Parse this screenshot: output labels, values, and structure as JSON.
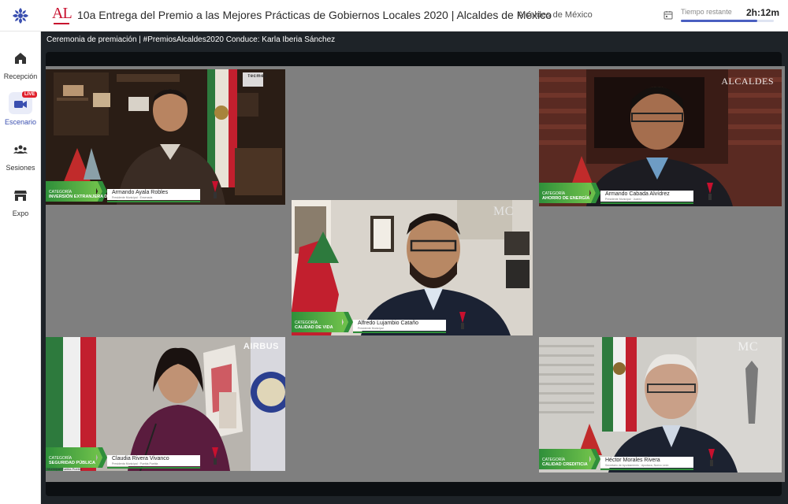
{
  "header": {
    "event_title": "10a Entrega del Premio a las Mejores Prácticas de Gobiernos Locales 2020 | Alcaldes de México",
    "org_name": "Alcaldes de México",
    "time_label": "Tiempo restante",
    "time_value": "2h:12m",
    "time_progress_fraction": 0.82,
    "accent_color": "#4a5fc1",
    "brand_color": "#c8102e",
    "logo_text": "AL"
  },
  "sidebar": {
    "items": [
      {
        "label": "Recepción",
        "icon": "home-icon"
      },
      {
        "label": "Escenario",
        "icon": "video-camera-icon",
        "badge": "LIVE",
        "active": true
      },
      {
        "label": "Sesiones",
        "icon": "people-icon"
      },
      {
        "label": "Expo",
        "icon": "store-icon"
      }
    ]
  },
  "stage": {
    "title": "Ceremonia de premiación | #PremiosAlcaldes2020 Conduce: Karla Iberia Sánchez",
    "tiles": [
      {
        "category_prefix": "Categoría",
        "category": "Inversión Extranjera Directa",
        "name": "Armando Ayala Robles",
        "subtitle": "Presidente Municipal · Ensenada",
        "watermark": "Tecmed"
      },
      {
        "category_prefix": "Categoría",
        "category": "Ahorro de Energía",
        "name": "Armando Cabada Alvídrez",
        "subtitle": "Presidente Municipal · Juárez",
        "watermark": "ALCALDES"
      },
      {
        "category_prefix": "Categoría",
        "category": "Calidad de Vida",
        "name": "Alfredo Lujambio Cataño",
        "subtitle": "Presidente Municipal",
        "watermark": "MC"
      },
      {
        "category_prefix": "Categoría",
        "category": "Seguridad Pública",
        "name": "Claudia Rivera Vivanco",
        "subtitle": "Presidenta Municipal · Puebla Puebla",
        "watermark": "AIRBUS",
        "footer_text": "Municipal Puebla Puebla"
      },
      {
        "category_prefix": "Categoría",
        "category": "Calidad Crediticia",
        "name": "Héctor Morales Rivera",
        "subtitle": "Secretario de Ayuntamiento · Apodaca, Nuevo León",
        "watermark": "MC"
      }
    ]
  }
}
